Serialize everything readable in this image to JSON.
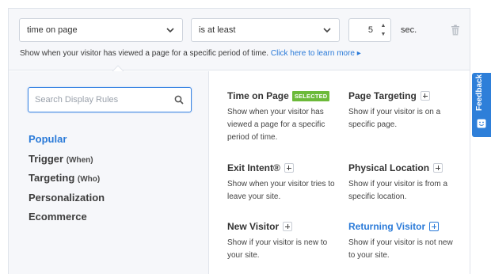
{
  "rulebar": {
    "condition_select": "time on page",
    "operator_select": "is at least",
    "seconds_value": "5",
    "unit": "sec.",
    "help_text": "Show when your visitor has viewed a page for a specific period of time.",
    "help_link": "Click here to learn more ▸"
  },
  "search": {
    "placeholder": "Search Display Rules"
  },
  "categories": [
    {
      "label": "Popular",
      "sub": ""
    },
    {
      "label": "Trigger",
      "sub": "(When)"
    },
    {
      "label": "Targeting",
      "sub": "(Who)"
    },
    {
      "label": "Personalization",
      "sub": ""
    },
    {
      "label": "Ecommerce",
      "sub": ""
    }
  ],
  "rules": [
    {
      "title": "Time on Page",
      "badge": "SELECTED",
      "desc": "Show when your visitor has viewed a page for a specific period of time."
    },
    {
      "title": "Page Targeting",
      "desc": "Show if your visitor is on a specific page."
    },
    {
      "title": "Exit Intent®",
      "desc": "Show when your visitor tries to leave your site."
    },
    {
      "title": "Physical Location",
      "desc": "Show if your visitor is from a specific location."
    },
    {
      "title": "New Visitor",
      "desc": "Show if your visitor is new to your site."
    },
    {
      "title": "Returning Visitor",
      "desc": "Show if your visitor is not new to your site."
    }
  ],
  "feedback": {
    "label": "Feedback"
  },
  "colors": {
    "accent": "#2a7ad8",
    "selected_badge": "#6cba3a",
    "feedback_tab": "#2e7fd9"
  },
  "icons": {
    "search": "search-icon",
    "trash": "trash-icon",
    "chevron": "chevron-down-icon",
    "plus": "plus-icon"
  }
}
